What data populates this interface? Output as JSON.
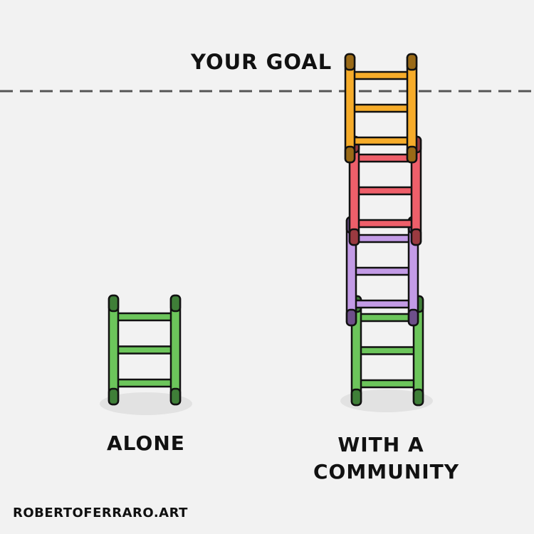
{
  "labels": {
    "goal": "YOUR GOAL",
    "alone": "ALONE",
    "community_line1": "WITH A",
    "community_line2": "COMMUNITY",
    "credit": "ROBERTOFERRARO.ART"
  },
  "colors": {
    "background": "#f2f2f2",
    "outline": "#111111",
    "goal_line": "#555555",
    "shadow": "#e2e2e2",
    "green": "#6cc55b",
    "green_cap": "#3f7f38",
    "purple": "#c39be6",
    "purple_cap": "#6e4f8a",
    "red": "#ee5f6a",
    "red_cap": "#9a3a40",
    "orange": "#f6ac2a",
    "orange_cap": "#9a6a17"
  },
  "ladders": {
    "alone": [
      "green"
    ],
    "community": [
      "green",
      "purple",
      "red",
      "orange"
    ]
  }
}
